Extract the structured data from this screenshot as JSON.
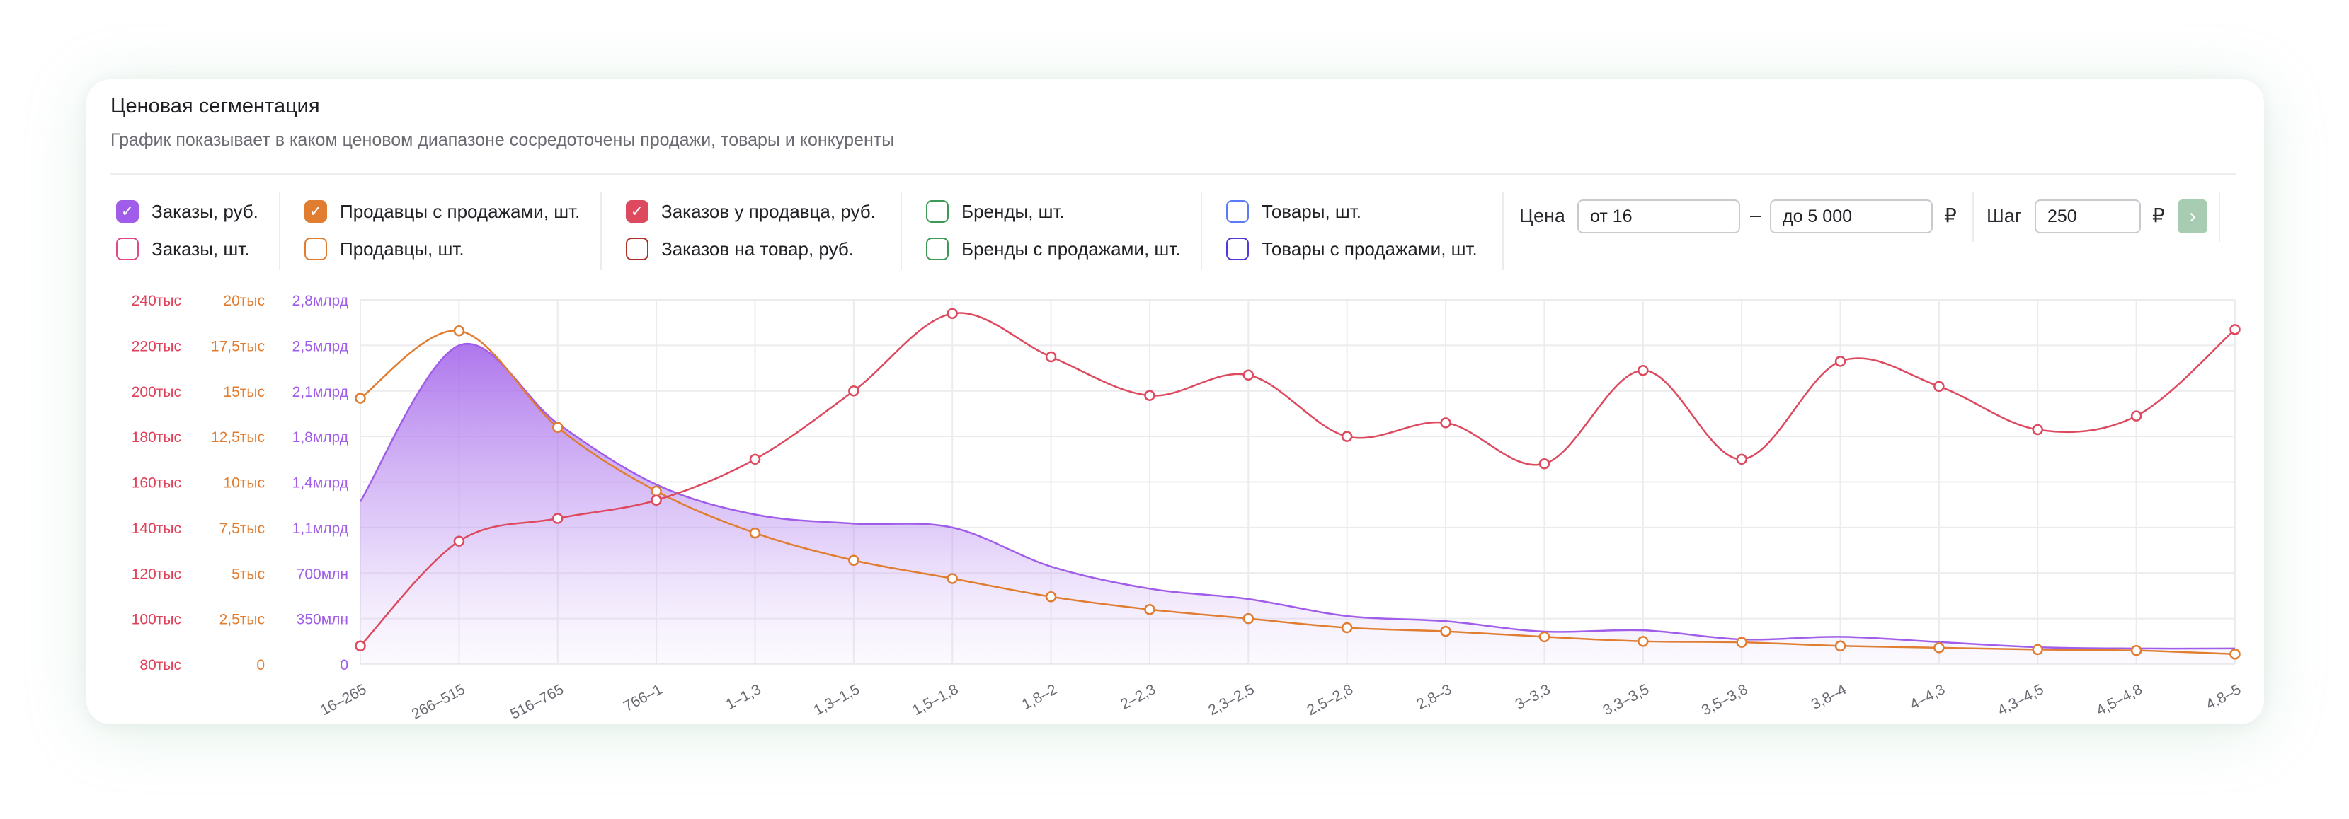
{
  "header": {
    "title": "Ценовая сегментация",
    "subtitle": "График показывает в каком ценовом диапазоне сосредоточены продажи, товары и конкуренты"
  },
  "legend": [
    {
      "label": "Заказы, руб.",
      "color": "#a05de9",
      "checked": true
    },
    {
      "label": "Заказы, шт.",
      "color": "#e0498a",
      "checked": false
    },
    {
      "label": "Продавцы с продажами, шт.",
      "color": "#e07d31",
      "checked": true
    },
    {
      "label": "Продавцы, шт.",
      "color": "#e07d31",
      "checked": false
    },
    {
      "label": "Заказов у продавца, руб.",
      "color": "#dd4a5f",
      "checked": true
    },
    {
      "label": "Заказов на товар, руб.",
      "color": "#b0302a",
      "checked": false
    },
    {
      "label": "Бренды, шт.",
      "color": "#3d9a56",
      "checked": false
    },
    {
      "label": "Бренды с продажами, шт.",
      "color": "#3d9a56",
      "checked": false
    },
    {
      "label": "Товары, шт.",
      "color": "#5b7cf5",
      "checked": false
    },
    {
      "label": "Товары с продажами, шт.",
      "color": "#5338e0",
      "checked": false
    }
  ],
  "filters": {
    "price_label": "Цена",
    "from_value": "от 16",
    "dash": "–",
    "to_value": "до 5 000",
    "currency": "₽",
    "step_label": "Шаг",
    "step_value": "250",
    "step_currency": "₽",
    "go_icon": "chevron-right-icon"
  },
  "chart_data": {
    "type": "line",
    "categories": [
      "16–265",
      "266–515",
      "516–765",
      "766–1",
      "1–1,3",
      "1,3–1,5",
      "1,5–1,8",
      "1,8–2",
      "2–2,3",
      "2,3–2,5",
      "2,5–2,8",
      "2,8–3",
      "3–3,3",
      "3,3–3,5",
      "3,5–3,8",
      "3,8–4",
      "4–4,3",
      "4,3–4,5",
      "4,5–4,8",
      "4,8–5"
    ],
    "axes": [
      {
        "id": "left1",
        "color": "#e0415a",
        "ticks": [
          "80тыс",
          "100тыс",
          "120тыс",
          "140тыс",
          "160тыс",
          "180тыс",
          "200тыс",
          "220тыс",
          "240тыс"
        ],
        "range": [
          80000,
          240000
        ]
      },
      {
        "id": "left2",
        "color": "#e07d31",
        "ticks": [
          "0",
          "2,5тыс",
          "5тыс",
          "7,5тыс",
          "10тыс",
          "12,5тыс",
          "15тыс",
          "17,5тыс",
          "20тыс"
        ],
        "range": [
          0,
          20000
        ]
      },
      {
        "id": "left3",
        "color": "#a05de9",
        "ticks": [
          "0",
          "350млн",
          "700млн",
          "1,1млрд",
          "1,4млрд",
          "1,8млрд",
          "2,1млрд",
          "2,5млрд",
          "2,8млрд"
        ],
        "range": [
          0,
          2800000000
        ]
      }
    ],
    "series": [
      {
        "name": "Заказы, руб.",
        "axis": "left3",
        "type": "area",
        "color": "#a05de9",
        "values": [
          1250000000,
          2450000000,
          1850000000,
          1380000000,
          1150000000,
          1080000000,
          1050000000,
          750000000,
          580000000,
          500000000,
          370000000,
          330000000,
          250000000,
          260000000,
          190000000,
          210000000,
          170000000,
          130000000,
          120000000,
          120000000
        ]
      },
      {
        "name": "Продавцы с продажами, шт.",
        "axis": "left2",
        "type": "line",
        "color": "#e07d31",
        "markers": true,
        "values": [
          14600,
          18300,
          13000,
          9500,
          7200,
          5700,
          4700,
          3700,
          3000,
          2500,
          2000,
          1800,
          1500,
          1250,
          1200,
          1000,
          900,
          800,
          750,
          550
        ]
      },
      {
        "name": "Заказов у продавца, руб.",
        "axis": "left1",
        "type": "line",
        "color": "#dd4a5f",
        "markers": true,
        "values": [
          88000,
          134000,
          144000,
          152000,
          170000,
          200000,
          234000,
          215000,
          198000,
          207000,
          180000,
          186000,
          168000,
          209000,
          170000,
          213000,
          202000,
          183000,
          189000,
          227000
        ]
      }
    ],
    "grid": true
  }
}
